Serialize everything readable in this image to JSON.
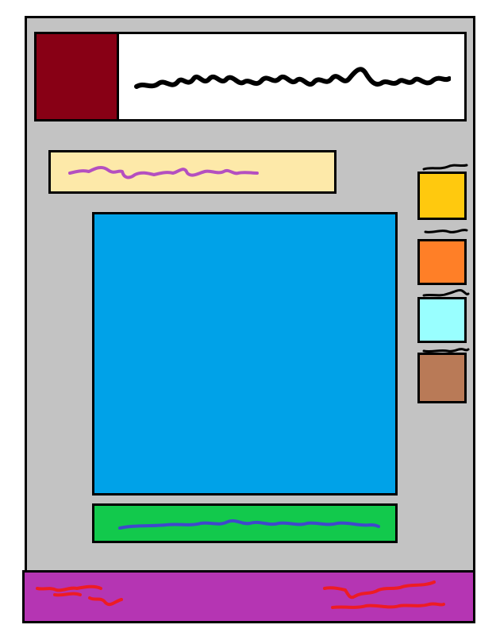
{
  "colors": {
    "window_background": "#c3c3c3",
    "logo": "#880015",
    "header_background": "#ffffff",
    "title_scribble": "#000000",
    "banner_background": "#fde9a9",
    "banner_scribble": "#b44fc0",
    "main_panel": "#00a2e8",
    "action_bar": "#12c94c",
    "action_bar_scribble": "#3f48cc",
    "footer": "#b535b3",
    "footer_scribble": "#ed1c24",
    "swatch_label_scribble": "#000000"
  },
  "swatches": [
    {
      "name": "swatch-yellow",
      "color": "#ffc90e"
    },
    {
      "name": "swatch-orange",
      "color": "#ff7f27"
    },
    {
      "name": "swatch-light-cyan",
      "color": "#99ffff"
    },
    {
      "name": "swatch-brown",
      "color": "#b97a57"
    }
  ]
}
